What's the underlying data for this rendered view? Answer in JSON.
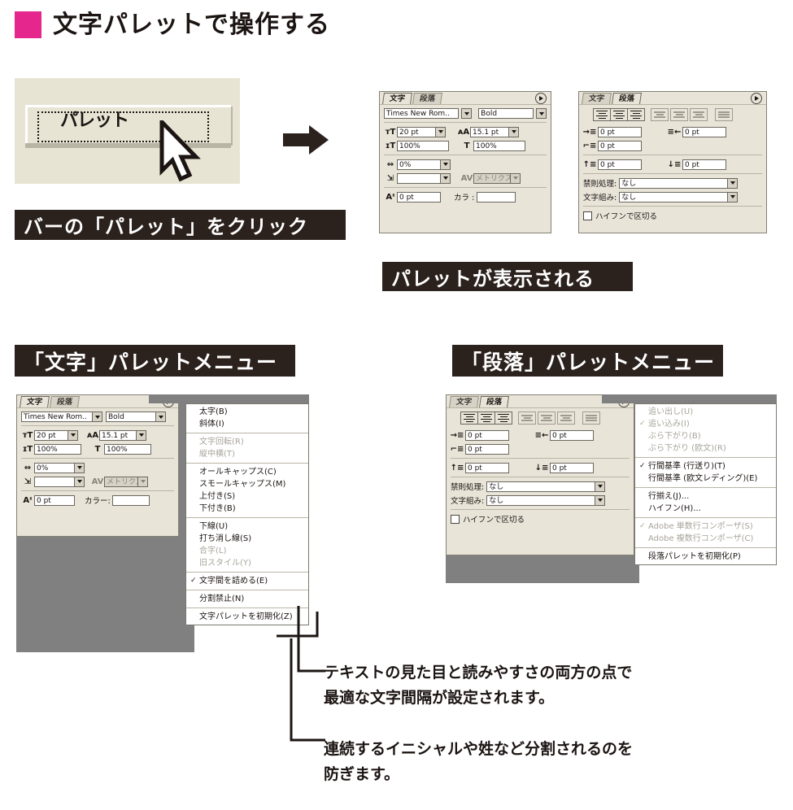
{
  "heading": {
    "square_color": "#e5268c",
    "title": "文字パレットで操作する"
  },
  "step1": {
    "screenshot": {
      "menu_word": "パレット",
      "cursor_icon": "arrow-cursor-icon"
    },
    "caption": "バーの「パレット」をクリック",
    "arrow_icon": "right-arrow-icon"
  },
  "step2": {
    "caption": "パレットが表示される",
    "character_palette": {
      "tabs": [
        {
          "label": "文字",
          "active": true
        },
        {
          "label": "段落",
          "active": false
        }
      ],
      "menu_button_icon": "palette-menu-icon",
      "font_family": "Times New Rom..",
      "font_style": "Bold",
      "font_size_icon": "font-size-icon",
      "font_size": "20 pt",
      "leading_icon": "leading-icon",
      "leading": "15.1 pt",
      "vertical_scale_icon": "vertical-scale-icon",
      "vertical_scale": "100%",
      "horizontal_scale_icon": "horizontal-scale-icon",
      "horizontal_scale": "100%",
      "tracking_icon": "tracking-icon",
      "tracking": "0%",
      "tsume_icon": "tsume-icon",
      "tsume": "",
      "kerning_icon": "kerning-icon",
      "kerning": "メトリクス",
      "baseline_icon": "baseline-shift-icon",
      "baseline_shift": "0 pt",
      "color_label": "カラ :",
      "color_value": ""
    },
    "paragraph_palette": {
      "tabs": [
        {
          "label": "文字",
          "active": false
        },
        {
          "label": "段落",
          "active": true
        }
      ],
      "menu_button_icon": "palette-menu-icon",
      "align_buttons": [
        "align-left-icon",
        "align-center-icon",
        "align-right-icon",
        "justify-last-left-icon",
        "justify-last-center-icon",
        "justify-last-right-icon",
        "justify-all-icon"
      ],
      "left_indent_icon": "left-indent-icon",
      "left_indent": "0 pt",
      "right_indent_icon": "right-indent-icon",
      "right_indent": "0 pt",
      "first_line_indent_icon": "first-line-indent-icon",
      "first_line_indent": "0 pt",
      "space_before_icon": "space-before-icon",
      "space_before": "0 pt",
      "space_after_icon": "space-after-icon",
      "space_after": "0 pt",
      "kinsoku_label": "禁則処理:",
      "kinsoku_value": "なし",
      "mojikumi_label": "文字組み:",
      "mojikumi_value": "なし",
      "hyphenate_label": "ハイフンで区切る",
      "hyphenate_checked": false
    }
  },
  "section_left": {
    "caption": "「文字」パレットメニュー",
    "palette": {
      "tabs": [
        {
          "label": "文字",
          "active": true
        },
        {
          "label": "段落",
          "active": false
        }
      ],
      "menu_button_icon": "palette-menu-icon",
      "font_family": "Times New Rom..",
      "font_style": "Bold",
      "font_size": "20 pt",
      "leading": "15.1 pt",
      "vertical_scale": "100%",
      "horizontal_scale": "100%",
      "tracking": "0%",
      "tsume": "",
      "kerning": "メトリクス",
      "baseline_shift": "0 pt",
      "color_label": "カラー:",
      "color_value": ""
    },
    "menu_items": [
      {
        "label": "太字(B)",
        "disabled": false,
        "checked": false
      },
      {
        "label": "斜体(I)",
        "disabled": false,
        "checked": false
      },
      {
        "sep": true
      },
      {
        "label": "文字回転(R)",
        "disabled": true,
        "checked": false
      },
      {
        "label": "縦中横(T)",
        "disabled": true,
        "checked": false
      },
      {
        "sep": true
      },
      {
        "label": "オールキャップス(C)",
        "disabled": false,
        "checked": false
      },
      {
        "label": "スモールキャップス(M)",
        "disabled": false,
        "checked": false
      },
      {
        "label": "上付き(S)",
        "disabled": false,
        "checked": false
      },
      {
        "label": "下付き(B)",
        "disabled": false,
        "checked": false
      },
      {
        "sep": true
      },
      {
        "label": "下線(U)",
        "disabled": false,
        "checked": false
      },
      {
        "label": "打ち消し線(S)",
        "disabled": false,
        "checked": false
      },
      {
        "label": "合字(L)",
        "disabled": true,
        "checked": false
      },
      {
        "label": "旧スタイル(Y)",
        "disabled": true,
        "checked": false
      },
      {
        "sep": true
      },
      {
        "label": "文字間を詰める(E)",
        "disabled": false,
        "checked": true
      },
      {
        "sep": true
      },
      {
        "label": "分割禁止(N)",
        "disabled": false,
        "checked": false
      },
      {
        "sep": true
      },
      {
        "label": "文字パレットを初期化(Z)",
        "disabled": false,
        "checked": false
      }
    ]
  },
  "section_right": {
    "caption": "「段落」パレットメニュー",
    "palette": {
      "tabs": [
        {
          "label": "文字",
          "active": false
        },
        {
          "label": "段落",
          "active": true
        }
      ],
      "menu_button_icon": "palette-menu-icon",
      "left_indent": "0 pt",
      "right_indent": "0 pt",
      "first_line_indent": "0 pt",
      "space_before": "0 pt",
      "space_after": "0 pt",
      "kinsoku_label": "禁則処理:",
      "kinsoku_value": "なし",
      "mojikumi_label": "文字組み:",
      "mojikumi_value": "なし",
      "hyphenate_label": "ハイフンで区切る"
    },
    "menu_items": [
      {
        "label": "追い出し(U)",
        "disabled": true,
        "checked": false
      },
      {
        "label": "追い込み(I)",
        "disabled": true,
        "checked": true
      },
      {
        "label": "ぶら下がり(B)",
        "disabled": true,
        "checked": false
      },
      {
        "label": "ぶら下がり (欧文)(R)",
        "disabled": true,
        "checked": false
      },
      {
        "sep": true
      },
      {
        "label": "行間基準 (行送り)(T)",
        "disabled": false,
        "checked": true
      },
      {
        "label": "行間基準 (欧文レディング)(E)",
        "disabled": false,
        "checked": false
      },
      {
        "sep": true
      },
      {
        "label": "行揃え(J)...",
        "disabled": false,
        "checked": false
      },
      {
        "label": "ハイフン(H)...",
        "disabled": false,
        "checked": false
      },
      {
        "sep": true
      },
      {
        "label": "Adobe 単数行コンポーザ(S)",
        "disabled": true,
        "checked": true
      },
      {
        "label": "Adobe 複数行コンポーザ(C)",
        "disabled": true,
        "checked": false
      },
      {
        "sep": true
      },
      {
        "label": "段落パレットを初期化(P)",
        "disabled": false,
        "checked": false
      }
    ]
  },
  "annotations": [
    {
      "text": "テキストの見た目と読みやすさの両方の点で\n最適な文字間隔が設定されます。"
    },
    {
      "text": "連続するイニシャルや姓など分割されるのを\n防ぎます。"
    }
  ]
}
